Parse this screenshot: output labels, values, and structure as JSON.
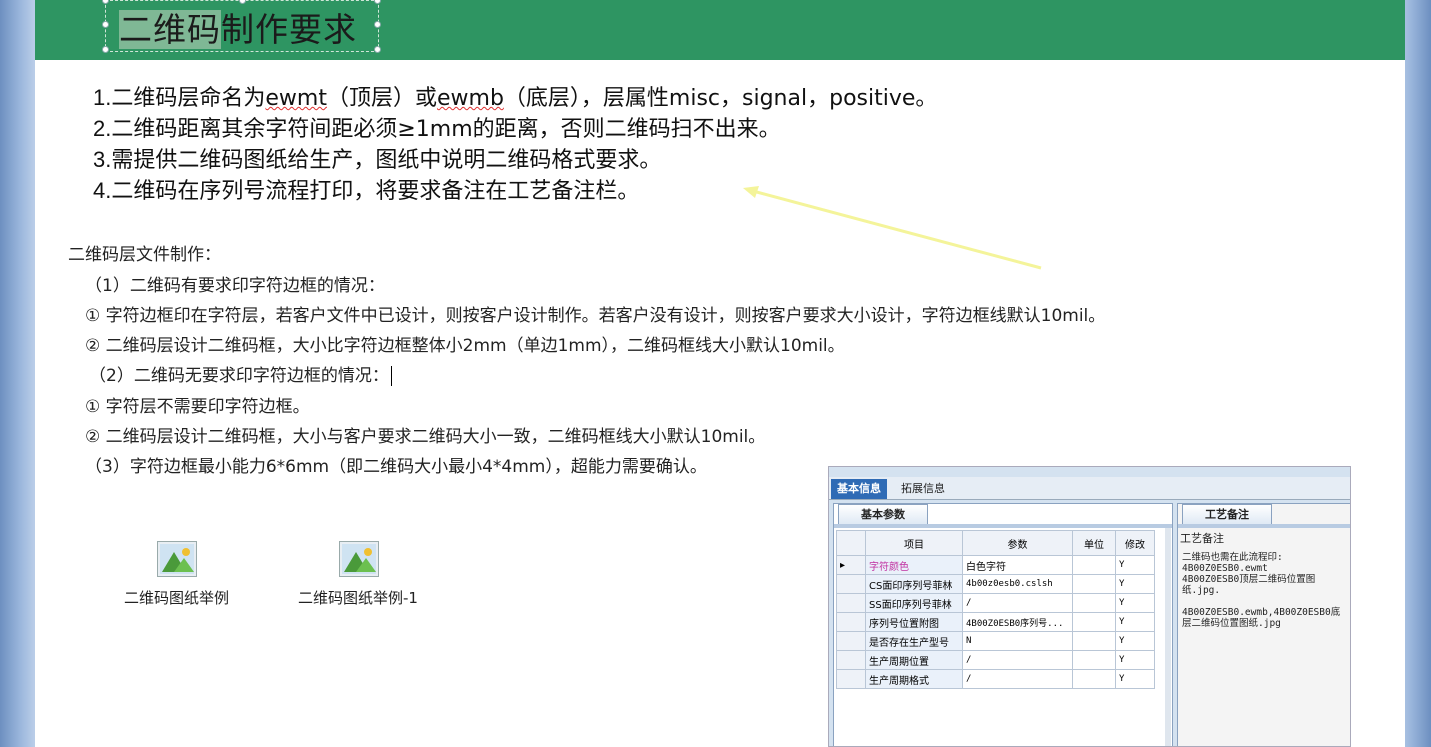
{
  "slide": {
    "title": {
      "highlighted": "二维码",
      "rest": "制作要求"
    },
    "requirements": [
      {
        "num": "1.",
        "parts": [
          "二维码层命名为",
          "ewmt",
          "（顶层）或",
          "ewmb",
          "（底层），层属性misc，signal，positive。"
        ]
      },
      {
        "num": "2.",
        "text": "二维码距离其余字符间距必须≥1mm的距离，否则二维码扫不出来。"
      },
      {
        "num": "3.",
        "text": "需提供二维码图纸给生产，图纸中说明二维码格式要求。"
      },
      {
        "num": "4.",
        "text": "二维码在序列号流程打印，将要求备注在工艺备注栏。"
      }
    ],
    "layer_heading": "二维码层文件制作：",
    "notes": [
      "（1）二维码有要求印字符边框的情况：",
      "①  字符边框印在字符层，若客户文件中已设计，则按客户设计制作。若客户没有设计，则按客户要求大小设计，字符边框线默认10mil。",
      "②  二维码层设计二维码框，大小比字符边框整体小2mm（单边1mm），二维码框线大小默认10mil。",
      "（2）二维码无要求印字符边框的情况：",
      "①  字符层不需要印字符边框。",
      "②  二维码层设计二维码框，大小与客户要求二维码大小一致，二维码框线大小默认10mil。",
      "（3）字符边框最小能力6*6mm（即二维码大小最小4*4mm），超能力需要确认。"
    ],
    "attachments": [
      "二维码图纸举例",
      "二维码图纸举例-1"
    ]
  },
  "app": {
    "tabs": [
      "基本信息",
      "拓展信息"
    ],
    "left_panel_tab": "基本参数",
    "right_panel_tab": "工艺备注",
    "columns": [
      "项目",
      "参数",
      "单位",
      "修改"
    ],
    "rows": [
      {
        "item": "字符颜色",
        "value": "白色字符",
        "unit": "",
        "modify": "Y"
      },
      {
        "item": "CS面印序列号菲林",
        "value": "4b00z0esb0.cslsh",
        "unit": "",
        "modify": "Y"
      },
      {
        "item": "SS面印序列号菲林",
        "value": "/",
        "unit": "",
        "modify": "Y"
      },
      {
        "item": "序列号位置附图",
        "value": "4B00Z0ESB0序列号...",
        "unit": "",
        "modify": "Y"
      },
      {
        "item": "是否存在生产型号",
        "value": "N",
        "unit": "",
        "modify": "Y"
      },
      {
        "item": "生产周期位置",
        "value": "/",
        "unit": "",
        "modify": "Y"
      },
      {
        "item": "生产周期格式",
        "value": "/",
        "unit": "",
        "modify": "Y"
      }
    ],
    "remark_label": "工艺备注",
    "remark_text": "二维码也需在此流程印:\n4B00Z0ESB0.ewmt\n4B00Z0ESB0顶层二维码位置图纸.jpg.\n\n4B00Z0ESB0.ewmb,4B00Z0ESB0底层二维码位置图纸.jpg"
  },
  "colors": {
    "title_bar": "#2e9562",
    "app_tab_active": "#2f6bb5",
    "arrow": "#f4f49a"
  }
}
